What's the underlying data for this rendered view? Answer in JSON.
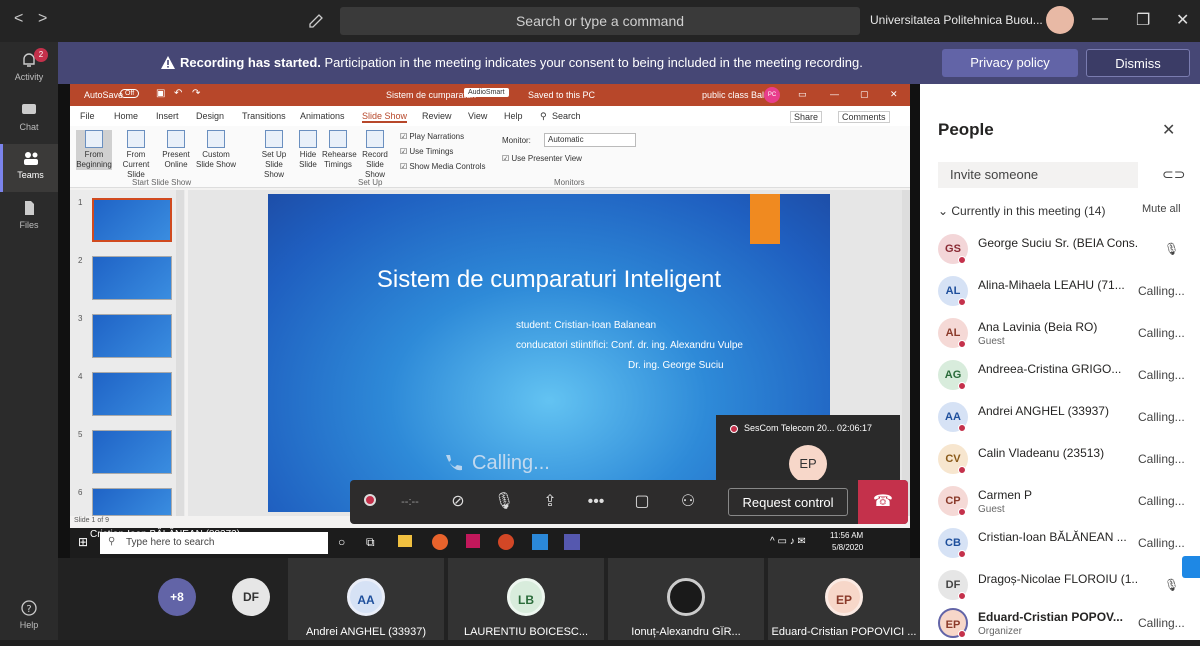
{
  "titlebar": {
    "search_placeholder": "Search or type a command",
    "org": "Universitatea Politehnica Bucu...",
    "back": "<",
    "forward": ">"
  },
  "rail": [
    {
      "label": "Activity",
      "badge": "2"
    },
    {
      "label": "Chat"
    },
    {
      "label": "Teams"
    },
    {
      "label": "Files"
    },
    {
      "label": "Help"
    }
  ],
  "banner": {
    "bold": "Recording has started.",
    "text": " Participation in the meeting indicates your consent to being included in the meeting recording.",
    "privacy": "Privacy policy",
    "dismiss": "Dismiss"
  },
  "ppt": {
    "autosave": "AutoSave",
    "autosave_state": "Off",
    "doc_title": "Sistem de cumparaturi",
    "doc_tag": "AudioSmart",
    "saved": "Saved to this PC",
    "user": "public class Bala",
    "user_initials": "PC",
    "tabs": [
      "File",
      "Home",
      "Insert",
      "Design",
      "Transitions",
      "Animations",
      "Slide Show",
      "Review",
      "View",
      "Help"
    ],
    "tell_me": "Search",
    "share": "Share",
    "comments": "Comments",
    "ribbon": {
      "from_beginning": "From Beginning",
      "from_current": "From Current Slide",
      "present_online": "Present Online",
      "custom_slide_show": "Custom Slide Show",
      "set_up": "Set Up Slide Show",
      "hide_slide": "Hide Slide",
      "rehearse": "Rehearse Timings",
      "record": "Record Slide Show",
      "play_narrations": "Play Narrations",
      "use_timings": "Use Timings",
      "show_media": "Show Media Controls",
      "monitor_label": "Monitor:",
      "monitor_value": "Automatic",
      "presenter_view": "Use Presenter View",
      "grp_start": "Start Slide Show",
      "grp_setup": "Set Up",
      "grp_monitors": "Monitors"
    },
    "thumb_numbers": [
      "1",
      "2",
      "3",
      "4",
      "5",
      "6"
    ],
    "slide": {
      "title": "Sistem de cumparaturi Inteligent",
      "line1": "student: Cristian-Ioan Balanean",
      "line2": "conducatori stiintifici: Conf. dr. ing. Alexandru Vulpe",
      "line3": "Dr. ing. George Suciu"
    },
    "status": "Slide 1 of 9",
    "taskbar_search": "Type here to search",
    "clock_time": "11:56 AM",
    "clock_date": "5/8/2020"
  },
  "stage": {
    "presenter_name": "Cristian-Ioan BĂLĂNEAN (88273)",
    "calling": "Calling..."
  },
  "pip": {
    "label": "SesCom Telecom 20...",
    "time": "02:06:17",
    "initials": "EP"
  },
  "controls": {
    "timer": "--:--",
    "request_control": "Request control"
  },
  "people": {
    "title": "People",
    "invite_placeholder": "Invite someone",
    "current": "Currently in this meeting",
    "count": "(14)",
    "mute_all": "Mute all",
    "list": [
      {
        "initials": "GS",
        "name": "George Suciu Sr. (BEIA Cons...",
        "sub": "",
        "status": "",
        "color": "#f3d6d8"
      },
      {
        "initials": "AL",
        "name": "Alina-Mihaela LEAHU (71...",
        "sub": "",
        "status": "Calling...",
        "color": "#d6e2f5"
      },
      {
        "initials": "AL",
        "name": "Ana Lavinia (Beia RO)",
        "sub": "Guest",
        "status": "Calling...",
        "color": "#f5d9d6"
      },
      {
        "initials": "AG",
        "name": "Andreea-Cristina GRIGO...",
        "sub": "",
        "status": "Calling...",
        "color": "#d8ecdc"
      },
      {
        "initials": "AA",
        "name": "Andrei ANGHEL (33937)",
        "sub": "",
        "status": "Calling...",
        "color": "#d6e2f5"
      },
      {
        "initials": "CV",
        "name": "Calin Vladeanu (23513)",
        "sub": "",
        "status": "Calling...",
        "color": "#f7e6cf"
      },
      {
        "initials": "CP",
        "name": "Carmen P",
        "sub": "Guest",
        "status": "Calling...",
        "color": "#f5d9d6"
      },
      {
        "initials": "CB",
        "name": "Cristian-Ioan BĂLĂNEAN ...",
        "sub": "",
        "status": "Calling...",
        "color": "#d6e2f5"
      },
      {
        "initials": "DF",
        "name": "Dragoș-Nicolae FLOROIU (1...",
        "sub": "",
        "status": "",
        "color": "#e6e6e6"
      },
      {
        "initials": "EP",
        "name": "Eduard-Cristian POPOV...",
        "sub": "Organizer",
        "status": "Calling...",
        "color": "#f7d7c9"
      }
    ]
  },
  "gallery": [
    {
      "initials": "+8",
      "name": ""
    },
    {
      "initials": "DF",
      "name": ""
    },
    {
      "initials": "AA",
      "name": "Andrei ANGHEL (33937)"
    },
    {
      "initials": "LB",
      "name": "LAURENTIU BOICESC..."
    },
    {
      "initials": "",
      "name": "Ionuț-Alexandru GÎR..."
    },
    {
      "initials": "EP",
      "name": "Eduard-Cristian POPOVICI ..."
    }
  ]
}
